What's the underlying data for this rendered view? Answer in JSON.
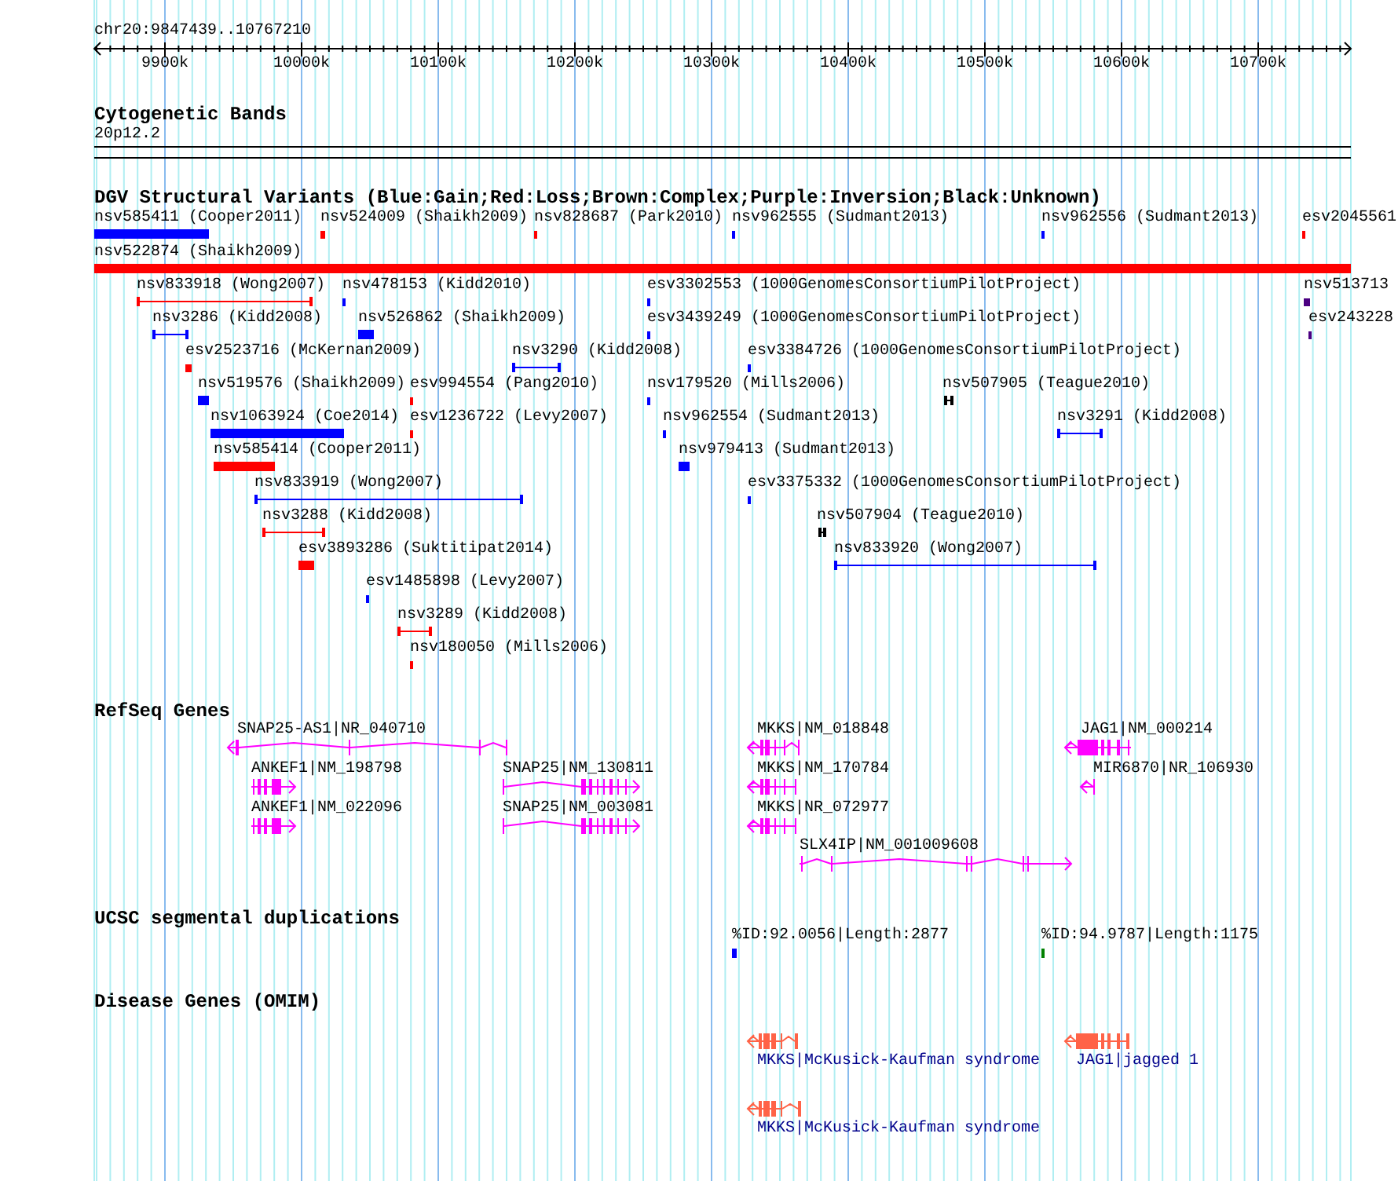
{
  "ruler": {
    "location": "chr20:9847439..10767210",
    "ticks": [
      "9900k",
      "10000k",
      "10100k",
      "10200k",
      "10300k",
      "10400k",
      "10500k",
      "10600k",
      "10700k"
    ]
  },
  "tracks": [
    {
      "kind": "cytoband",
      "title": "Cytogenetic Bands",
      "features": [
        {
          "label": "20p12.2"
        }
      ]
    },
    {
      "kind": "variants",
      "title": "DGV Structural Variants (Blue:Gain;Red:Loss;Brown:Complex;Purple:Inversion;Black:Unknown)",
      "features": [
        {
          "label": "nsv585411 (Cooper2011)",
          "kind": "bar",
          "color": "#0000ff"
        },
        {
          "label": "nsv524009 (Shaikh2009)",
          "kind": "bar",
          "color": "#ff0000"
        },
        {
          "label": "nsv828687 (Park2010)",
          "kind": "bar",
          "color": "#ff0000"
        },
        {
          "label": "nsv962555 (Sudmant2013)",
          "kind": "bar",
          "color": "#0000ff"
        },
        {
          "label": "nsv962556 (Sudmant2013)",
          "kind": "bar",
          "color": "#0000ff"
        },
        {
          "label": "esv2045561",
          "kind": "bar",
          "color": "#ff0000"
        },
        {
          "label": "nsv522874 (Shaikh2009)",
          "kind": "bar",
          "color": "#ff0000"
        },
        {
          "label": "nsv833918 (Wong2007)",
          "kind": "interval",
          "color": "#ff0000"
        },
        {
          "label": "nsv478153 (Kidd2010)",
          "kind": "bar",
          "color": "#0000ff"
        },
        {
          "label": "esv3302553 (1000GenomesConsortiumPilotProject)",
          "kind": "bar",
          "color": "#0000ff"
        },
        {
          "label": "nsv513713",
          "kind": "bar",
          "color": "#4b0082"
        },
        {
          "label": "nsv3286 (Kidd2008)",
          "kind": "interval",
          "color": "#0000ff"
        },
        {
          "label": "nsv526862 (Shaikh2009)",
          "kind": "bar",
          "color": "#0000ff"
        },
        {
          "label": "esv3439249 (1000GenomesConsortiumPilotProject)",
          "kind": "bar",
          "color": "#0000ff"
        },
        {
          "label": "esv243228",
          "kind": "bar",
          "color": "#4b0082"
        },
        {
          "label": "esv2523716 (McKernan2009)",
          "kind": "bar",
          "color": "#ff0000"
        },
        {
          "label": "nsv3290 (Kidd2008)",
          "kind": "interval",
          "color": "#0000ff"
        },
        {
          "label": "esv3384726 (1000GenomesConsortiumPilotProject)",
          "kind": "bar",
          "color": "#0000ff"
        },
        {
          "label": "nsv519576 (Shaikh2009)",
          "kind": "bar",
          "color": "#0000ff"
        },
        {
          "label": "esv994554 (Pang2010)",
          "kind": "bar",
          "color": "#ff0000"
        },
        {
          "label": "nsv179520 (Mills2006)",
          "kind": "bar",
          "color": "#0000ff"
        },
        {
          "label": "nsv507905 (Teague2010)",
          "kind": "interval",
          "color": "#000000"
        },
        {
          "label": "nsv1063924 (Coe2014)",
          "kind": "bar",
          "color": "#0000ff"
        },
        {
          "label": "esv1236722 (Levy2007)",
          "kind": "bar",
          "color": "#ff0000"
        },
        {
          "label": "nsv962554 (Sudmant2013)",
          "kind": "bar",
          "color": "#0000ff"
        },
        {
          "label": "nsv3291 (Kidd2008)",
          "kind": "interval",
          "color": "#0000ff"
        },
        {
          "label": "nsv585414 (Cooper2011)",
          "kind": "bar",
          "color": "#ff0000"
        },
        {
          "label": "nsv979413 (Sudmant2013)",
          "kind": "bar",
          "color": "#0000ff"
        },
        {
          "label": "nsv833919 (Wong2007)",
          "kind": "interval",
          "color": "#0000ff"
        },
        {
          "label": "esv3375332 (1000GenomesConsortiumPilotProject)",
          "kind": "bar",
          "color": "#0000ff"
        },
        {
          "label": "nsv3288 (Kidd2008)",
          "kind": "interval",
          "color": "#ff0000"
        },
        {
          "label": "nsv507904 (Teague2010)",
          "kind": "interval",
          "color": "#000000"
        },
        {
          "label": "esv3893286 (Suktitipat2014)",
          "kind": "bar",
          "color": "#ff0000"
        },
        {
          "label": "nsv833920 (Wong2007)",
          "kind": "interval",
          "color": "#0000ff"
        },
        {
          "label": "esv1485898 (Levy2007)",
          "kind": "bar",
          "color": "#0000ff"
        },
        {
          "label": "nsv3289 (Kidd2008)",
          "kind": "interval",
          "color": "#ff0000"
        },
        {
          "label": "nsv180050 (Mills2006)",
          "kind": "bar",
          "color": "#ff0000"
        }
      ]
    },
    {
      "kind": "genes",
      "title": "RefSeq Genes",
      "features": [
        {
          "label": "SNAP25-AS1|NR_040710",
          "reverse": true
        },
        {
          "label": "MKKS|NM_018848",
          "reverse": true
        },
        {
          "label": "JAG1|NM_000214",
          "reverse": true
        },
        {
          "label": "ANKEF1|NM_198798",
          "reverse": false
        },
        {
          "label": "SNAP25|NM_130811",
          "reverse": false
        },
        {
          "label": "MKKS|NM_170784",
          "reverse": true
        },
        {
          "label": "MIR6870|NR_106930",
          "reverse": true
        },
        {
          "label": "ANKEF1|NM_022096",
          "reverse": false
        },
        {
          "label": "SNAP25|NM_003081",
          "reverse": false
        },
        {
          "label": "MKKS|NR_072977",
          "reverse": true
        },
        {
          "label": "SLX4IP|NM_001009608",
          "reverse": false
        }
      ]
    },
    {
      "kind": "segdups",
      "title": "UCSC segmental duplications",
      "features": [
        {
          "label": "%ID:92.0056|Length:2877",
          "color": "#0000ff"
        },
        {
          "label": "%ID:94.9787|Length:1175",
          "color": "#008000"
        }
      ]
    },
    {
      "kind": "disease",
      "title": "Disease Genes (OMIM)",
      "features": [
        {
          "label": "MKKS|McKusick-Kaufman syndrome",
          "reverse": true
        },
        {
          "label": "JAG1|jagged 1",
          "reverse": true
        },
        {
          "label": "MKKS|McKusick-Kaufman syndrome",
          "reverse": true
        }
      ]
    }
  ]
}
